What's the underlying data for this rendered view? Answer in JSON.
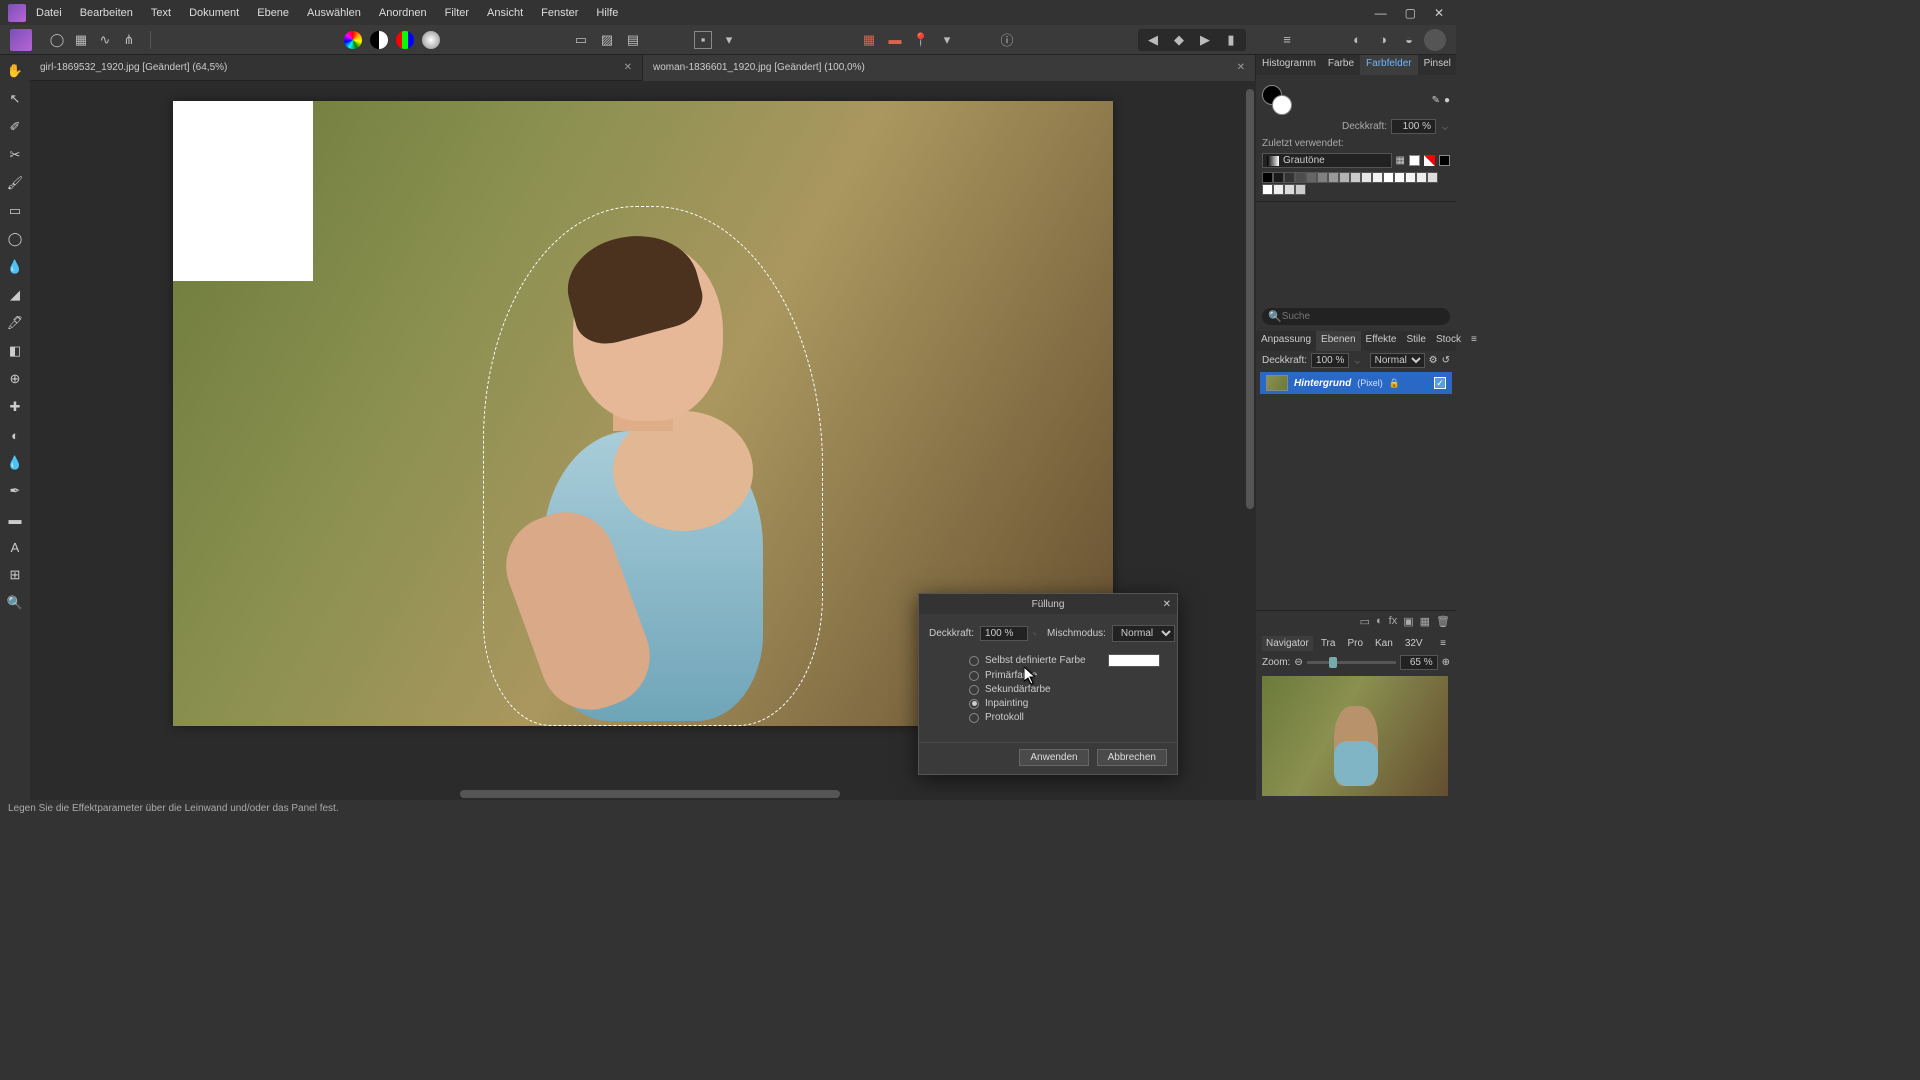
{
  "menu": [
    "Datei",
    "Bearbeiten",
    "Text",
    "Dokument",
    "Ebene",
    "Auswählen",
    "Anordnen",
    "Filter",
    "Ansicht",
    "Fenster",
    "Hilfe"
  ],
  "tabs": [
    {
      "label": "girl-1869532_1920.jpg [Geändert] (64,5%)",
      "active": false
    },
    {
      "label": "woman-1836601_1920.jpg [Geändert] (100,0%)",
      "active": true
    }
  ],
  "rightTabs1": [
    "Histogramm",
    "Farbe",
    "Farbfelder",
    "Pinsel"
  ],
  "rightTabs1Active": "Farbfelder",
  "opacityLabel": "Deckkraft:",
  "opacityValue": "100 %",
  "recentLabel": "Zuletzt verwendet:",
  "paletteName": "Grautöne",
  "searchPlaceholder": "Suche",
  "layerTabs": [
    "Anpassung",
    "Ebenen",
    "Effekte",
    "Stile",
    "Stock"
  ],
  "layerTabsActive": "Ebenen",
  "blendLabel": "Normal",
  "layerName": "Hintergrund",
  "layerType": "(Pixel)",
  "navTabs": [
    "Navigator",
    "Tra",
    "Pro",
    "Kan",
    "32V"
  ],
  "navTabsActive": "Navigator",
  "zoomLabel": "Zoom:",
  "zoomValue": "65 %",
  "dialog": {
    "title": "Füllung",
    "opacityLabel": "Deckkraft:",
    "opacityValue": "100 %",
    "blendLabel": "Mischmodus:",
    "blendValue": "Normal",
    "opt1": "Selbst definierte Farbe",
    "opt2": "Primärfarbe",
    "opt3": "Sekundärfarbe",
    "opt4": "Inpainting",
    "opt5": "Protokoll",
    "apply": "Anwenden",
    "cancel": "Abbrechen"
  },
  "status": "Legen Sie die Effektparameter über die Leinwand und/oder das Panel fest."
}
